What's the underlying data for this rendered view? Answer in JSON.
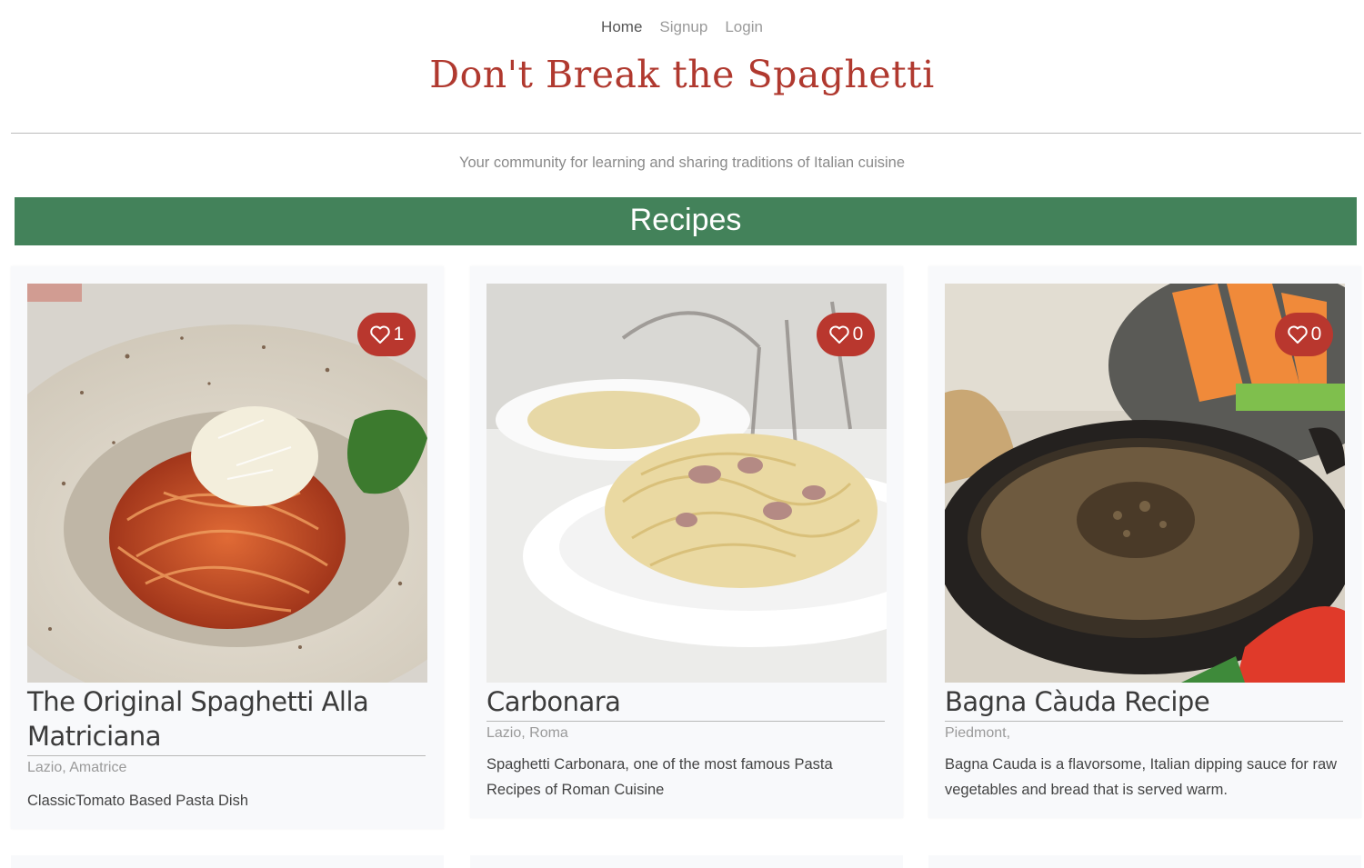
{
  "nav": {
    "home": "Home",
    "signup": "Signup",
    "login": "Login"
  },
  "site": {
    "title": "Don't Break the Spaghetti",
    "tagline": "Your community for learning and sharing traditions of Italian cuisine"
  },
  "section": {
    "heading": "Recipes"
  },
  "colors": {
    "brand_red": "#b0392f",
    "banner_green": "#43825a",
    "like_badge": "#b9372e"
  },
  "recipes": [
    {
      "title": "The Original Spaghetti Alla Matriciana",
      "region": "Lazio, Amatrice",
      "description": "ClassicTomato Based Pasta Dish",
      "likes": "1",
      "like_icon": "heart-outline-icon"
    },
    {
      "title": "Carbonara",
      "region": "Lazio, Roma",
      "description": "Spaghetti Carbonara, one of the most famous Pasta Recipes of Roman Cuisine",
      "likes": "0",
      "like_icon": "heart-outline-icon"
    },
    {
      "title": "Bagna Càuda Recipe",
      "region": "Piedmont,",
      "description": "Bagna Cauda is a flavorsome, Italian dipping sauce for raw vegetables and bread that is served warm.",
      "likes": "0",
      "like_icon": "heart-outline-icon"
    }
  ]
}
